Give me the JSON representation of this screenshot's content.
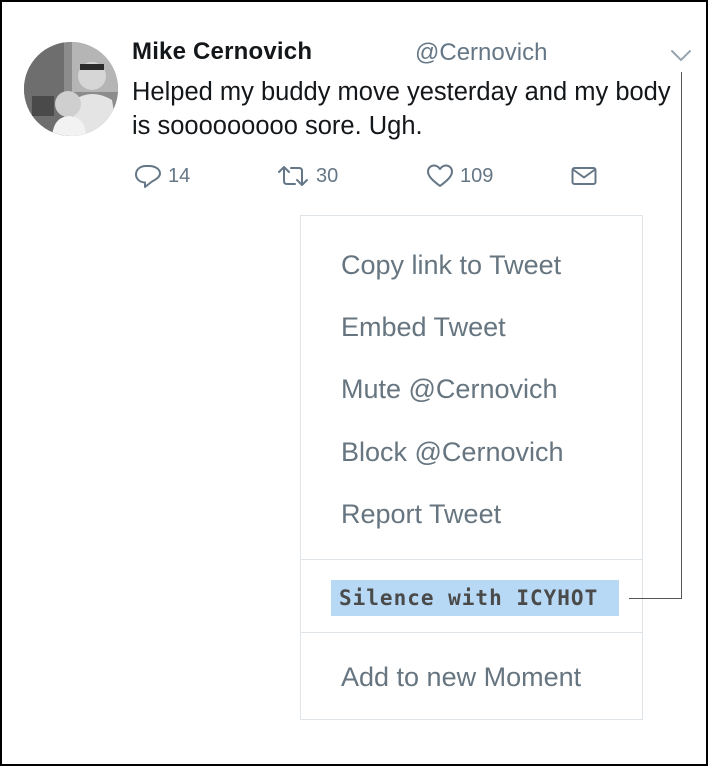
{
  "tweet": {
    "author_name": "Mike Cernovich",
    "author_handle": "@Cernovich",
    "text": "Helped my buddy move yesterday and my body is sooooooooo sore. Ugh.",
    "actions": {
      "reply_count": "14",
      "retweet_count": "30",
      "like_count": "109"
    }
  },
  "menu": {
    "items": [
      "Copy link to Tweet",
      "Embed Tweet",
      "Mute @Cernovich",
      "Block @Cernovich",
      "Report Tweet"
    ],
    "highlight_item": "Silence with ICYHOT",
    "moment_item": "Add to new Moment"
  },
  "icons": {
    "caret": "chevron-down-icon",
    "reply": "reply-icon",
    "retweet": "retweet-icon",
    "like": "heart-icon",
    "dm": "envelope-icon"
  },
  "colors": {
    "highlight": "#b7d9f5",
    "muted_text": "#657786",
    "menu_text": "#66757f"
  }
}
